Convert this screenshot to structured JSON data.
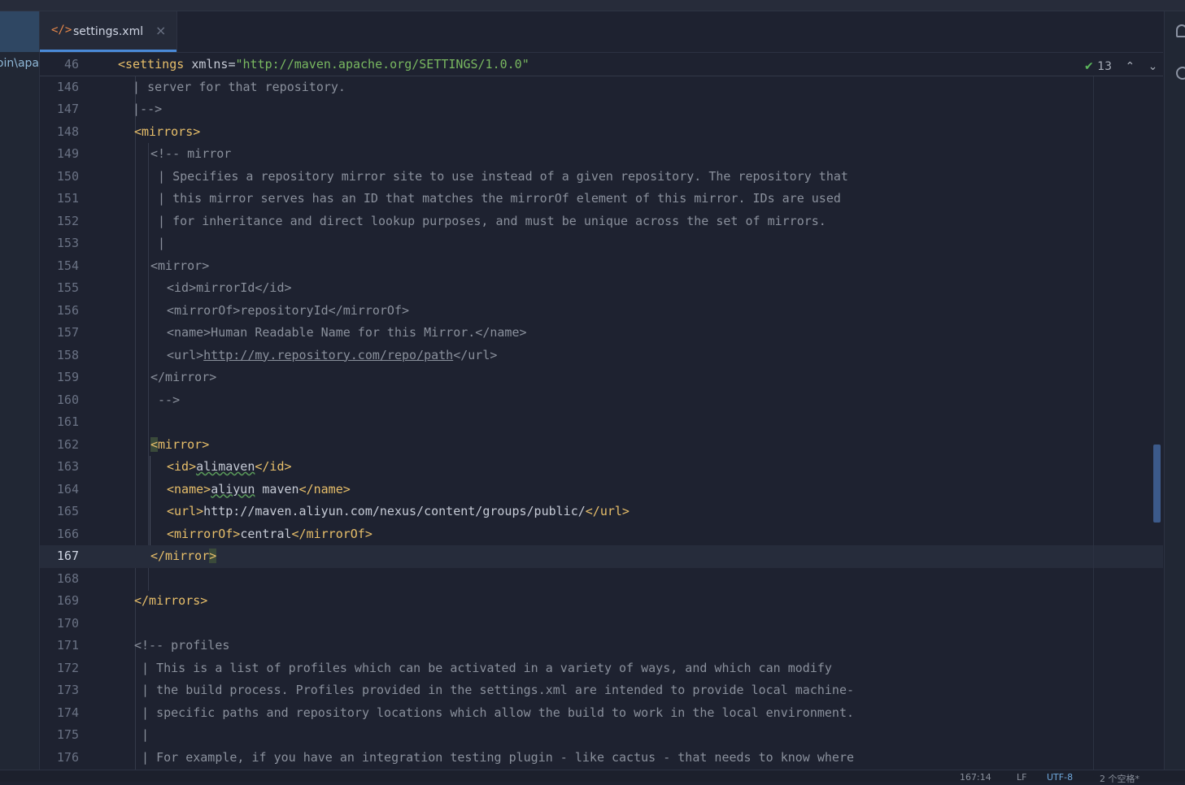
{
  "left_panel": {
    "path_fragment": "oin\\apa"
  },
  "tab": {
    "icon": "xml-icon",
    "label": "settings.xml",
    "close_glyph": "×"
  },
  "sticky_line": {
    "number": "46",
    "tag_open": "<settings",
    "attr": "xmlns",
    "eq": "=",
    "value": "\"http://maven.apache.org/SETTINGS/1.0.0\""
  },
  "inspections": {
    "count": "13",
    "up": "⌃",
    "down": "⌄"
  },
  "lines": [
    {
      "n": "146",
      "text": "  | server for that repository."
    },
    {
      "n": "147",
      "text": "  |-->"
    },
    {
      "n": "148",
      "text": "<mirrors>"
    },
    {
      "n": "149",
      "text": "<!-- mirror"
    },
    {
      "n": "150",
      "text": " | Specifies a repository mirror site to use instead of a given repository. The repository that"
    },
    {
      "n": "151",
      "text": " | this mirror serves has an ID that matches the mirrorOf element of this mirror. IDs are used"
    },
    {
      "n": "152",
      "text": " | for inheritance and direct lookup purposes, and must be unique across the set of mirrors."
    },
    {
      "n": "153",
      "text": " |"
    },
    {
      "n": "154",
      "text": "<mirror>"
    },
    {
      "n": "155",
      "text": "<id>mirrorId</id>"
    },
    {
      "n": "156",
      "text": "<mirrorOf>repositoryId</mirrorOf>"
    },
    {
      "n": "157",
      "text": "<name>Human Readable Name for this Mirror.</name>"
    },
    {
      "n": "158",
      "pre": "<url>",
      "link": "http://my.repository.com/repo/path",
      "post": "</url>"
    },
    {
      "n": "159",
      "text": "</mirror>"
    },
    {
      "n": "160",
      "text": " -->"
    },
    {
      "n": "161",
      "text": ""
    },
    {
      "n": "162",
      "text": "<mirror>"
    },
    {
      "n": "163",
      "o": "<id>",
      "v": "alimaven",
      "c": "</id>"
    },
    {
      "n": "164",
      "o": "<name>",
      "v1": "aliyun",
      "v2": " maven",
      "c": "</name>"
    },
    {
      "n": "165",
      "o": "<url>",
      "v": "http://maven.aliyun.com/nexus/content/groups/public/",
      "c": "</url>"
    },
    {
      "n": "166",
      "o": "<mirrorOf>",
      "v": "central",
      "c": "</mirrorOf>"
    },
    {
      "n": "167",
      "text": "</mirror>"
    },
    {
      "n": "168",
      "text": ""
    },
    {
      "n": "169",
      "text": "</mirrors>"
    },
    {
      "n": "170",
      "text": ""
    },
    {
      "n": "171",
      "text": "<!-- profiles"
    },
    {
      "n": "172",
      "text": " | This is a list of profiles which can be activated in a variety of ways, and which can modify"
    },
    {
      "n": "173",
      "text": " | the build process. Profiles provided in the settings.xml are intended to provide local machine-"
    },
    {
      "n": "174",
      "text": " | specific paths and repository locations which allow the build to work in the local environment."
    },
    {
      "n": "175",
      "text": " |"
    },
    {
      "n": "176",
      "text": " | For example, if you have an integration testing plugin - like cactus - that needs to know where"
    }
  ],
  "status": {
    "position": "167:14",
    "indent": "LF",
    "encoding": "UTF-8",
    "spaces": "2 个空格*"
  },
  "colors": {
    "tag": "#e8bf6a",
    "comment": "#8a909c",
    "string": "#79b860",
    "accent": "#4a8ad8"
  }
}
